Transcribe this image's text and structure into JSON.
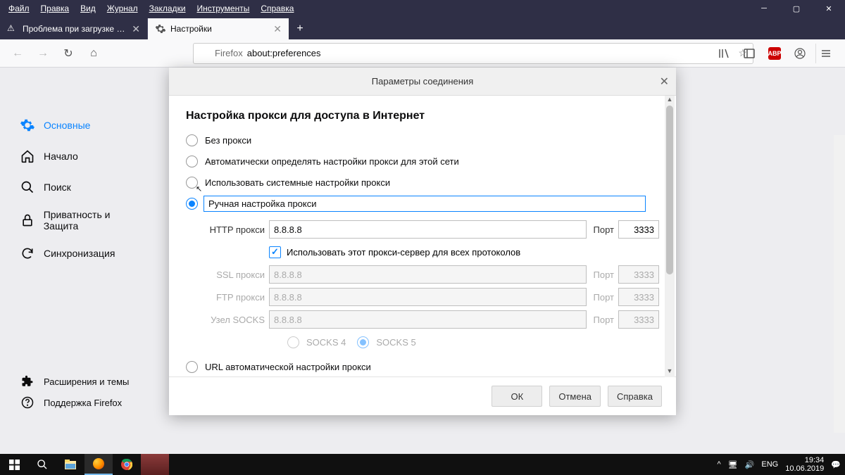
{
  "menubar": [
    "Файл",
    "Правка",
    "Вид",
    "Журнал",
    "Закладки",
    "Инструменты",
    "Справка"
  ],
  "tabs": {
    "inactive": {
      "label": "Проблема при загрузке стран"
    },
    "active": {
      "label": "Настройки"
    }
  },
  "urlbar": {
    "identity": "Firefox",
    "url": "about:preferences"
  },
  "sidebar": {
    "items": [
      {
        "label": "Основные",
        "icon": "gear"
      },
      {
        "label": "Начало",
        "icon": "home"
      },
      {
        "label": "Поиск",
        "icon": "search"
      },
      {
        "label": "Приватность и Защита",
        "icon": "lock"
      },
      {
        "label": "Синхронизация",
        "icon": "sync"
      }
    ],
    "bottom": [
      {
        "label": "Расширения и темы",
        "icon": "puzzle"
      },
      {
        "label": "Поддержка Firefox",
        "icon": "help"
      }
    ]
  },
  "dialog": {
    "title": "Параметры соединения",
    "heading": "Настройка прокси для доступа в Интернет",
    "options": {
      "noproxy": "Без прокси",
      "auto": "Автоматически определять настройки прокси для этой сети",
      "system": "Использовать системные настройки прокси",
      "manual": "Ручная настройка прокси",
      "url": "URL автоматической настройки прокси"
    },
    "labels": {
      "http": "HTTP прокси",
      "ssl": "SSL прокси",
      "ftp": "FTP прокси",
      "socks": "Узел SOCKS",
      "port": "Порт",
      "useforall": "Использовать этот прокси-сервер для всех протоколов",
      "socks4": "SOCKS 4",
      "socks5": "SOCKS 5"
    },
    "values": {
      "http_host": "8.8.8.8",
      "http_port": "3333",
      "ssl_host": "8.8.8.8",
      "ssl_port": "3333",
      "ftp_host": "8.8.8.8",
      "ftp_port": "3333",
      "socks_host": "8.8.8.8",
      "socks_port": "3333"
    },
    "buttons": {
      "ok": "ОК",
      "cancel": "Отмена",
      "help": "Справка"
    }
  },
  "systray": {
    "lang": "ENG",
    "time": "19:34",
    "date": "10.06.2019"
  }
}
